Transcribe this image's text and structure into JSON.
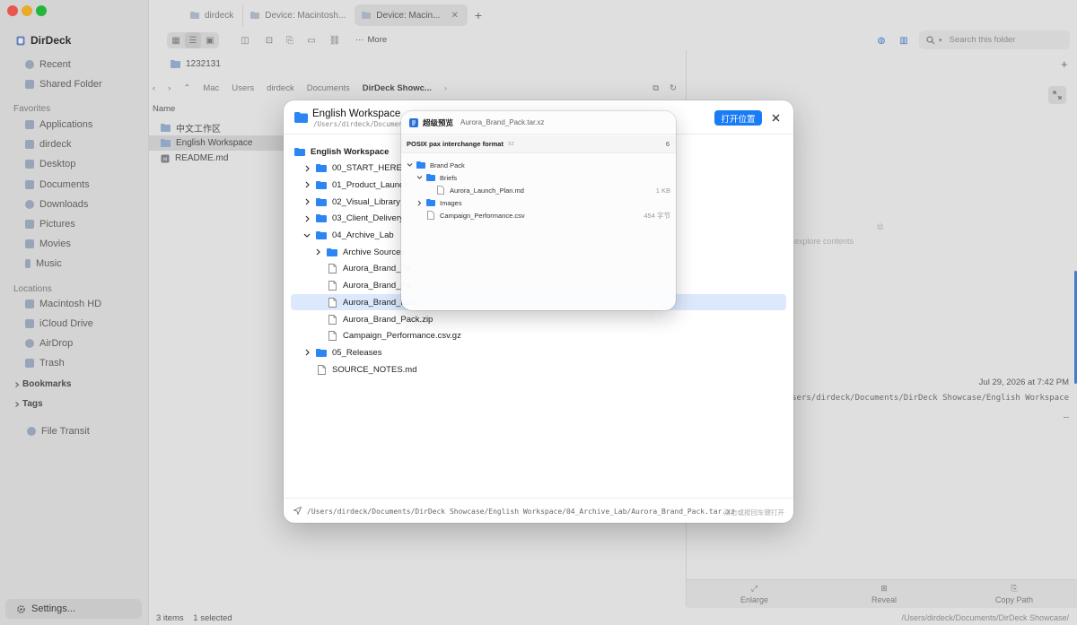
{
  "app": {
    "name": "DirDeck",
    "settings_label": "Settings..."
  },
  "sidebar": {
    "top_items": [
      {
        "label": "Recent",
        "icon": "clock-icon"
      },
      {
        "label": "Shared Folder",
        "icon": "shared-folder-icon"
      }
    ],
    "favorites_header": "Favorites",
    "favorites": [
      {
        "label": "Applications",
        "icon": "applications-icon"
      },
      {
        "label": "dirdeck",
        "icon": "home-icon"
      },
      {
        "label": "Desktop",
        "icon": "desktop-icon"
      },
      {
        "label": "Documents",
        "icon": "document-icon"
      },
      {
        "label": "Downloads",
        "icon": "download-icon"
      },
      {
        "label": "Pictures",
        "icon": "picture-icon"
      },
      {
        "label": "Movies",
        "icon": "movie-icon"
      },
      {
        "label": "Music",
        "icon": "music-icon"
      }
    ],
    "locations_header": "Locations",
    "locations": [
      {
        "label": "Macintosh HD",
        "icon": "disk-icon"
      },
      {
        "label": "iCloud Drive",
        "icon": "cloud-icon"
      },
      {
        "label": "AirDrop",
        "icon": "airdrop-icon"
      },
      {
        "label": "Trash",
        "icon": "trash-icon"
      }
    ],
    "bookmarks_label": "Bookmarks",
    "tags_label": "Tags",
    "file_transit_label": "File Transit"
  },
  "tabs": [
    {
      "label": "dirdeck",
      "active": false
    },
    {
      "label": "Device: Macintosh...",
      "active": false
    },
    {
      "label": "Device: Macin...",
      "active": true
    }
  ],
  "toolbar": {
    "more_label": "More",
    "search_placeholder": "Search this folder"
  },
  "path_tab_label": "1232131",
  "breadcrumbs": [
    "Mac",
    "Users",
    "dirdeck",
    "Documents",
    "DirDeck Showc..."
  ],
  "list": {
    "column_name": "Name",
    "rows": [
      {
        "label": "中文工作区",
        "type": "folder",
        "selected": false
      },
      {
        "label": "English Workspace",
        "type": "folder",
        "selected": true
      },
      {
        "label": "README.md",
        "type": "md",
        "selected": false
      }
    ]
  },
  "right_pane": {
    "explore_hint": "to explore contents",
    "dash": "--",
    "date": "Jul 29, 2026 at 7:42 PM",
    "path": "/Users/dirdeck/Documents/DirDeck Showcase/English Workspace",
    "actions": [
      {
        "label": "Enlarge",
        "icon": "enlarge-icon"
      },
      {
        "label": "Reveal",
        "icon": "reveal-icon"
      },
      {
        "label": "Copy Path",
        "icon": "copy-path-icon"
      }
    ]
  },
  "status": {
    "items": "3 items",
    "selected": "1 selected",
    "path": "/Users/dirdeck/Documents/DirDeck Showcase/"
  },
  "modal": {
    "title": "English Workspace",
    "subtitle": "/Users/dirdeck/Documents",
    "open_button": "打开位置",
    "tree": [
      {
        "label": "English Workspace",
        "type": "folder",
        "level": 0,
        "chevron": "none",
        "bold": true
      },
      {
        "label": "00_START_HERE",
        "type": "folder",
        "level": 1,
        "chevron": "right"
      },
      {
        "label": "01_Product_Launch",
        "type": "folder",
        "level": 1,
        "chevron": "right"
      },
      {
        "label": "02_Visual_Library",
        "type": "folder",
        "level": 1,
        "chevron": "right"
      },
      {
        "label": "03_Client_Delivery",
        "type": "folder",
        "level": 1,
        "chevron": "right"
      },
      {
        "label": "04_Archive_Lab",
        "type": "folder",
        "level": 1,
        "chevron": "down"
      },
      {
        "label": "Archive Sources",
        "type": "folder",
        "level": 2,
        "chevron": "right"
      },
      {
        "label": "Aurora_Brand_Pa",
        "type": "file",
        "level": 2,
        "chevron": "none"
      },
      {
        "label": "Aurora_Brand_Pa",
        "type": "file",
        "level": 2,
        "chevron": "none"
      },
      {
        "label": "Aurora_Brand_Pac",
        "type": "file",
        "level": 2,
        "chevron": "none",
        "selected": true
      },
      {
        "label": "Aurora_Brand_Pack.zip",
        "type": "file",
        "level": 2,
        "chevron": "none"
      },
      {
        "label": "Campaign_Performance.csv.gz",
        "type": "file",
        "level": 2,
        "chevron": "none"
      },
      {
        "label": "05_Releases",
        "type": "folder",
        "level": 1,
        "chevron": "right"
      },
      {
        "label": "SOURCE_NOTES.md",
        "type": "file",
        "level": 1,
        "chevron": "none"
      }
    ],
    "footer_path": "/Users/dirdeck/Documents/DirDeck Showcase/English Workspace/04_Archive_Lab/Aurora_Brand_Pack.tar.xz",
    "footer_hint": "双击或按回车键打开"
  },
  "popover": {
    "title": "超级预览",
    "filename": "Aurora_Brand_Pack.tar.xz",
    "format": "POSIX pax interchange format",
    "compression": "xz",
    "count": "6",
    "tree": [
      {
        "label": "Brand Pack",
        "type": "folder",
        "level": 0,
        "chevron": "down",
        "size": ""
      },
      {
        "label": "Briefs",
        "type": "folder",
        "level": 1,
        "chevron": "down",
        "size": ""
      },
      {
        "label": "Aurora_Launch_Plan.md",
        "type": "file",
        "level": 2,
        "chevron": "none",
        "size": "1 KB"
      },
      {
        "label": "Images",
        "type": "folder",
        "level": 1,
        "chevron": "right",
        "size": ""
      },
      {
        "label": "Campaign_Performance.csv",
        "type": "file",
        "level": 1,
        "chevron": "none",
        "size": "454 字节"
      }
    ]
  },
  "colors": {
    "accent": "#1a7cf5",
    "folder": "#2b86f3",
    "selection": "#dce9fc",
    "traffic_red": "#ff5f57",
    "traffic_yellow": "#febc2e",
    "traffic_green": "#28c840"
  }
}
